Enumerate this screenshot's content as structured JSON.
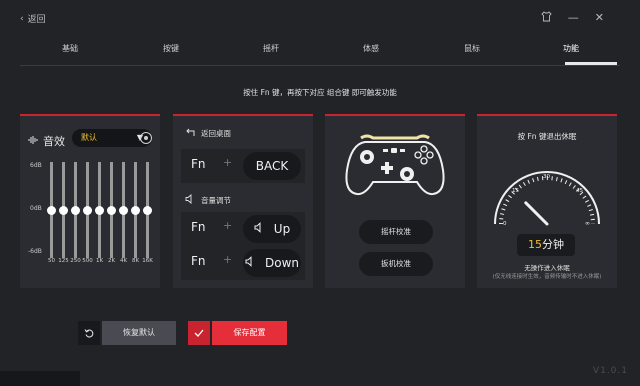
{
  "titlebar": {
    "back_label": "返回"
  },
  "tabs": [
    {
      "label": "基础"
    },
    {
      "label": "按键"
    },
    {
      "label": "摇杆"
    },
    {
      "label": "体感"
    },
    {
      "label": "鼠标"
    },
    {
      "label": "功能",
      "active": true
    }
  ],
  "hint": "按住 Fn 键，再按下对应 组合键 即可触发功能",
  "equalizer": {
    "title": "音效",
    "preset": "默认",
    "db_labels": [
      "6dB",
      "0dB",
      "-6dB"
    ],
    "bands": [
      {
        "freq": "50",
        "gain_db": 0
      },
      {
        "freq": "125",
        "gain_db": 0
      },
      {
        "freq": "250",
        "gain_db": 0
      },
      {
        "freq": "500",
        "gain_db": 0
      },
      {
        "freq": "1K",
        "gain_db": 0
      },
      {
        "freq": "2K",
        "gain_db": 0
      },
      {
        "freq": "4K",
        "gain_db": 0
      },
      {
        "freq": "8K",
        "gain_db": 0
      },
      {
        "freq": "16K",
        "gain_db": 0
      }
    ]
  },
  "shortcuts": {
    "desktop_title": "返回桌面",
    "volume_title": "音量调节",
    "modifier": "Fn",
    "plus": "+",
    "back_key": "BACK",
    "up_key": "Up",
    "down_key": "Down"
  },
  "gamepad": {
    "stick_calibration": "摇杆校准",
    "trigger_calibration": "扳机校准"
  },
  "sleep": {
    "hint": "按 Fn 键退出休眠",
    "dial_ticks": [
      "15",
      "30",
      "45",
      "∞"
    ],
    "dial_zero": "0",
    "minutes_value": "15",
    "minutes_unit": "分钟",
    "label": "无操作进入休眠",
    "note": "(仅无线连接时生效，音频传输时不进入休眠)",
    "value_minutes": 15
  },
  "actions": {
    "reset_label": "恢复默认",
    "save_label": "保存配置"
  },
  "footer": {
    "version": "V1.0.1"
  },
  "colors": {
    "accent": "#c8232f",
    "save": "#e62d3a",
    "highlight": "#f0c030"
  }
}
